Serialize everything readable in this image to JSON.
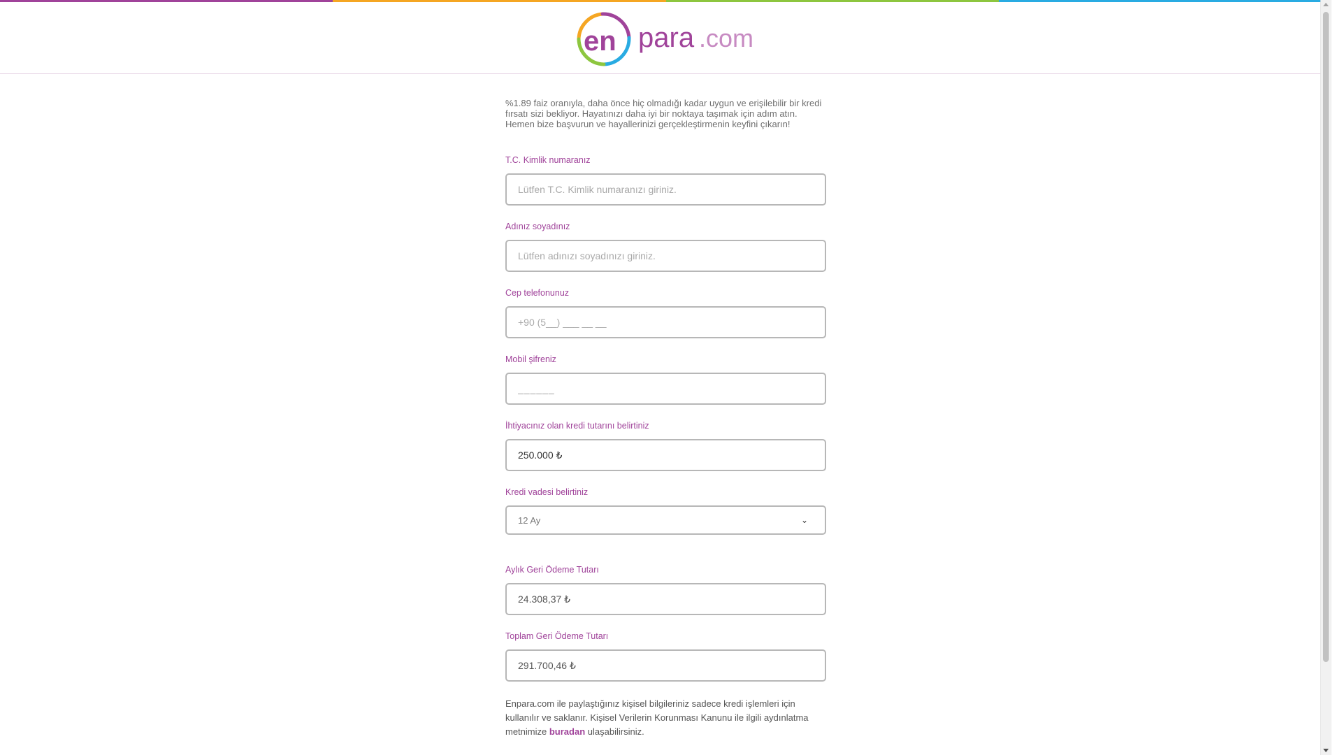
{
  "topbar_colors": [
    "#a0439a",
    "#f5a623",
    "#8dc63f",
    "#29abe2"
  ],
  "logo": {
    "text_en": "en",
    "text_para": "para",
    "text_com": ".com",
    "colors": {
      "en": "#a0439a",
      "para": "#a0439a",
      "com": "#a0439a",
      "ring": [
        "#a0439a",
        "#8dc63f",
        "#29abe2",
        "#f5a623"
      ]
    }
  },
  "intro": "%1.89 faiz oranıyla, daha önce hiç olmadığı kadar uygun ve erişilebilir bir kredi fırsatı sizi bekliyor. Hayatınızı daha iyi bir noktaya taşımak için adım atın. Hemen bize başvurun ve hayallerinizi gerçekleştirmenin keyfini çıkarın!",
  "form": {
    "tckn": {
      "label": "T.C. Kimlik numaranız",
      "placeholder": "Lütfen T.C. Kimlik numaranızı giriniz.",
      "value": ""
    },
    "name": {
      "label": "Adınız soyadınız",
      "placeholder": "Lütfen adınızı soyadınızı giriniz.",
      "value": ""
    },
    "phone": {
      "label": "Cep telefonunuz",
      "placeholder": "+90 (5__) ___ __ __",
      "value": ""
    },
    "password": {
      "label": "Mobil şifreniz",
      "value": "______"
    },
    "amount": {
      "label": "İhtiyacınız olan kredi tutarını belirtiniz",
      "value": "250.000 ₺"
    },
    "term": {
      "label": "Kredi vadesi belirtiniz",
      "selected": "12 Ay"
    },
    "monthly": {
      "label": "Aylık Geri Ödeme Tutarı",
      "value": "24.308,37 ₺"
    },
    "total": {
      "label": "Toplam Geri Ödeme Tutarı",
      "value": "291.700,46 ₺"
    }
  },
  "footnote": {
    "before": "Enpara.com ile paylaştığınız kişisel bilgileriniz sadece kredi işlemleri için kullanılır ve saklanır. Kişisel Verilerin Korunması Kanunu ile ilgili aydınlatma metnimize ",
    "link": "buradan",
    "after": " ulaşabilirsiniz."
  },
  "accent_color": "#a0439a"
}
